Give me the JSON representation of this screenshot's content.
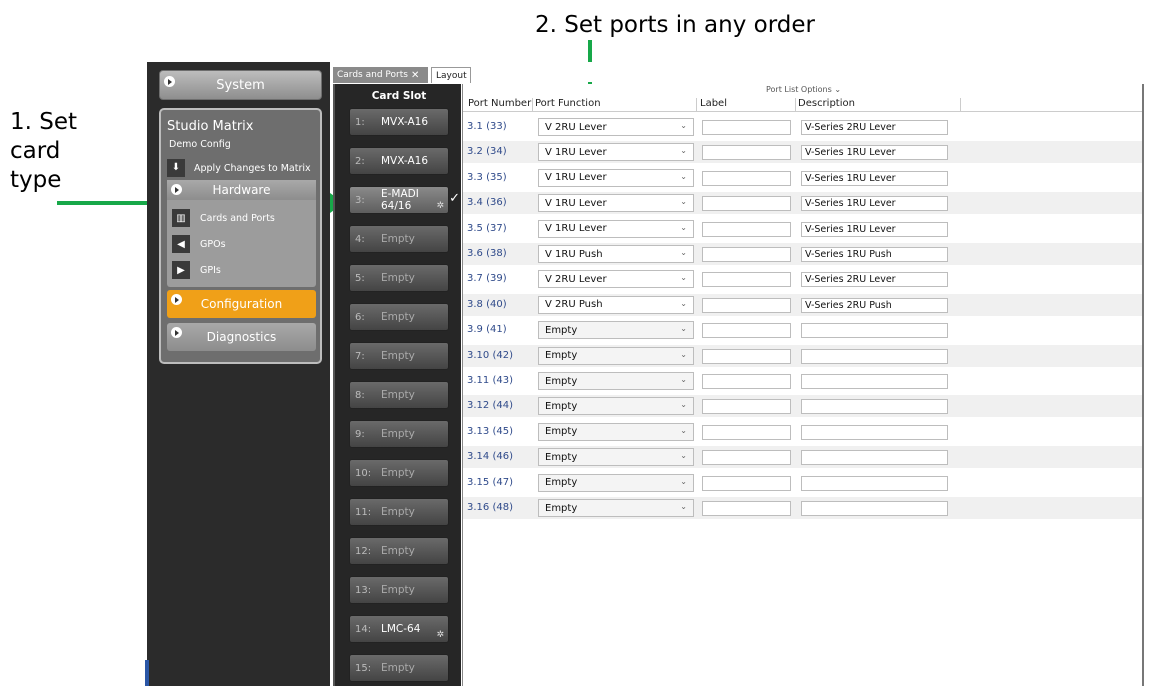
{
  "annotations": {
    "step1": [
      "1. Set",
      "card",
      "type"
    ],
    "step2": "2. Set ports in any order"
  },
  "colors": {
    "accent_orange": "#f0a018",
    "arrow_green": "#17a849",
    "port_number_blue": "#2f4a8a"
  },
  "nav": {
    "system_label": "System",
    "panel_title": "Studio Matrix",
    "panel_subtitle": "Demo Config",
    "apply_label": "Apply Changes to Matrix",
    "hardware_label": "Hardware",
    "hardware_items": [
      {
        "label": "Cards and Ports",
        "icon": "cards-ports-icon"
      },
      {
        "label": "GPOs",
        "icon": "gpo-icon"
      },
      {
        "label": "GPIs",
        "icon": "gpi-icon"
      }
    ],
    "configuration_label": "Configuration",
    "diagnostics_label": "Diagnostics"
  },
  "tabs": [
    {
      "label": "Cards and Ports",
      "active": true
    },
    {
      "label": "Layout",
      "active": false
    }
  ],
  "slots": {
    "header": "Card Slot",
    "items": [
      {
        "num": "1:",
        "name": "MVX-A16"
      },
      {
        "num": "2:",
        "name": "MVX-A16"
      },
      {
        "num": "3:",
        "name": "E-MADI",
        "name2": "64/16"
      },
      {
        "num": "4:",
        "name": "Empty"
      },
      {
        "num": "5:",
        "name": "Empty"
      },
      {
        "num": "6:",
        "name": "Empty"
      },
      {
        "num": "7:",
        "name": "Empty"
      },
      {
        "num": "8:",
        "name": "Empty"
      },
      {
        "num": "9:",
        "name": "Empty"
      },
      {
        "num": "10:",
        "name": "Empty"
      },
      {
        "num": "11:",
        "name": "Empty"
      },
      {
        "num": "12:",
        "name": "Empty"
      },
      {
        "num": "13:",
        "name": "Empty"
      },
      {
        "num": "14:",
        "name": "LMC-64"
      },
      {
        "num": "15:",
        "name": "Empty"
      }
    ]
  },
  "port_list": {
    "options_label": "Port List Options ⌄",
    "columns": {
      "number": "Port Number",
      "function": "Port Function",
      "label": "Label",
      "description": "Description"
    },
    "rows": [
      {
        "number": "3.1 (33)",
        "function": "V 2RU Lever",
        "label": "",
        "description": "V-Series 2RU Lever"
      },
      {
        "number": "3.2 (34)",
        "function": "V 1RU Lever",
        "label": "",
        "description": "V-Series 1RU Lever"
      },
      {
        "number": "3.3 (35)",
        "function": "V 1RU Lever",
        "label": "",
        "description": "V-Series 1RU Lever"
      },
      {
        "number": "3.4 (36)",
        "function": "V 1RU Lever",
        "label": "",
        "description": "V-Series 1RU Lever"
      },
      {
        "number": "3.5 (37)",
        "function": "V 1RU Lever",
        "label": "",
        "description": "V-Series 1RU Lever"
      },
      {
        "number": "3.6 (38)",
        "function": "V 1RU Push",
        "label": "",
        "description": "V-Series 1RU Push"
      },
      {
        "number": "3.7 (39)",
        "function": "V 2RU Lever",
        "label": "",
        "description": "V-Series 2RU Lever"
      },
      {
        "number": "3.8 (40)",
        "function": "V 2RU Push",
        "label": "",
        "description": "V-Series 2RU Push"
      },
      {
        "number": "3.9 (41)",
        "function": "Empty",
        "label": "",
        "description": ""
      },
      {
        "number": "3.10 (42)",
        "function": "Empty",
        "label": "",
        "description": ""
      },
      {
        "number": "3.11 (43)",
        "function": "Empty",
        "label": "",
        "description": ""
      },
      {
        "number": "3.12 (44)",
        "function": "Empty",
        "label": "",
        "description": ""
      },
      {
        "number": "3.13 (45)",
        "function": "Empty",
        "label": "",
        "description": ""
      },
      {
        "number": "3.14 (46)",
        "function": "Empty",
        "label": "",
        "description": ""
      },
      {
        "number": "3.15 (47)",
        "function": "Empty",
        "label": "",
        "description": ""
      },
      {
        "number": "3.16 (48)",
        "function": "Empty",
        "label": "",
        "description": ""
      }
    ]
  }
}
